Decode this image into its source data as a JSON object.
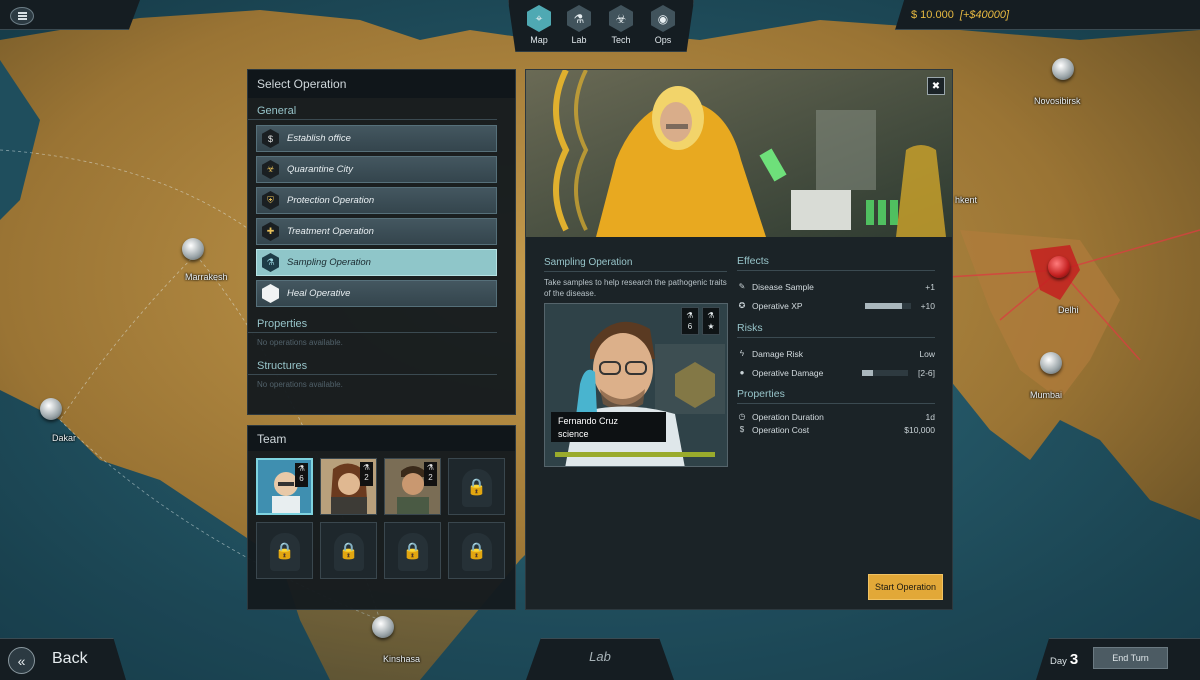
{
  "top_bar": {
    "money": "$ 10.000",
    "income": "[+$40000]",
    "nav": [
      {
        "label": "Map",
        "icon": "map-marker-icon"
      },
      {
        "label": "Lab",
        "icon": "flask-icon"
      },
      {
        "label": "Tech",
        "icon": "biohazard-icon"
      },
      {
        "label": "Ops",
        "icon": "agent-icon"
      }
    ]
  },
  "map_cities": {
    "novosibirsk": "Novosibirsk",
    "marrakesh": "Marrakesh",
    "dakar": "Dakar",
    "delhi": "Delhi",
    "mumbai": "Mumbai",
    "kinshasa": "Kinshasa",
    "partial": "hkent"
  },
  "select_operation": {
    "title": "Select Operation",
    "general_label": "General",
    "operations": [
      {
        "label": "Establish office",
        "icon": "dollar-icon"
      },
      {
        "label": "Quarantine City",
        "icon": "biohazard-icon"
      },
      {
        "label": "Protection Operation",
        "icon": "shield-icon"
      },
      {
        "label": "Treatment Operation",
        "icon": "medical-icon"
      },
      {
        "label": "Sampling Operation",
        "icon": "sample-flask-icon"
      },
      {
        "label": "Heal Operative",
        "icon": "heal-hex-icon"
      }
    ],
    "properties_label": "Properties",
    "properties_note": "No operations available.",
    "structures_label": "Structures",
    "structures_note": "No operations available."
  },
  "team": {
    "title": "Team",
    "members": [
      {
        "level": "6",
        "selected": true
      },
      {
        "level": "2",
        "selected": false
      },
      {
        "level": "2",
        "selected": false
      }
    ]
  },
  "detail": {
    "title": "Sampling Operation",
    "description": "Take samples to help research the pathogenic traits of the disease.",
    "agent_name": "Fernando Cruz",
    "agent_role": "science",
    "agent_level": "6",
    "effects_label": "Effects",
    "effects": [
      {
        "label": "Disease Sample",
        "value": "+1",
        "icon": "syringe-icon"
      },
      {
        "label": "Operative XP",
        "value": "+10",
        "icon": "xp-icon",
        "bar": 0.82
      }
    ],
    "risks_label": "Risks",
    "risks": [
      {
        "label": "Damage Risk",
        "value": "Low",
        "icon": "lightning-icon"
      },
      {
        "label": "Operative Damage",
        "value": "[2-6]",
        "icon": "bomb-icon",
        "bar": 0.25
      }
    ],
    "properties_label": "Properties",
    "properties": [
      {
        "label": "Operation Duration",
        "value": "1d",
        "icon": "clock-icon"
      },
      {
        "label": "Operation Cost",
        "value": "$10,000",
        "icon": "dollar-icon"
      }
    ],
    "start_label": "Start Operation"
  },
  "bottom_bar": {
    "back_label": "Back",
    "context_label": "Lab",
    "day_label": "Day",
    "day_value": "3",
    "end_turn_label": "End Turn"
  }
}
